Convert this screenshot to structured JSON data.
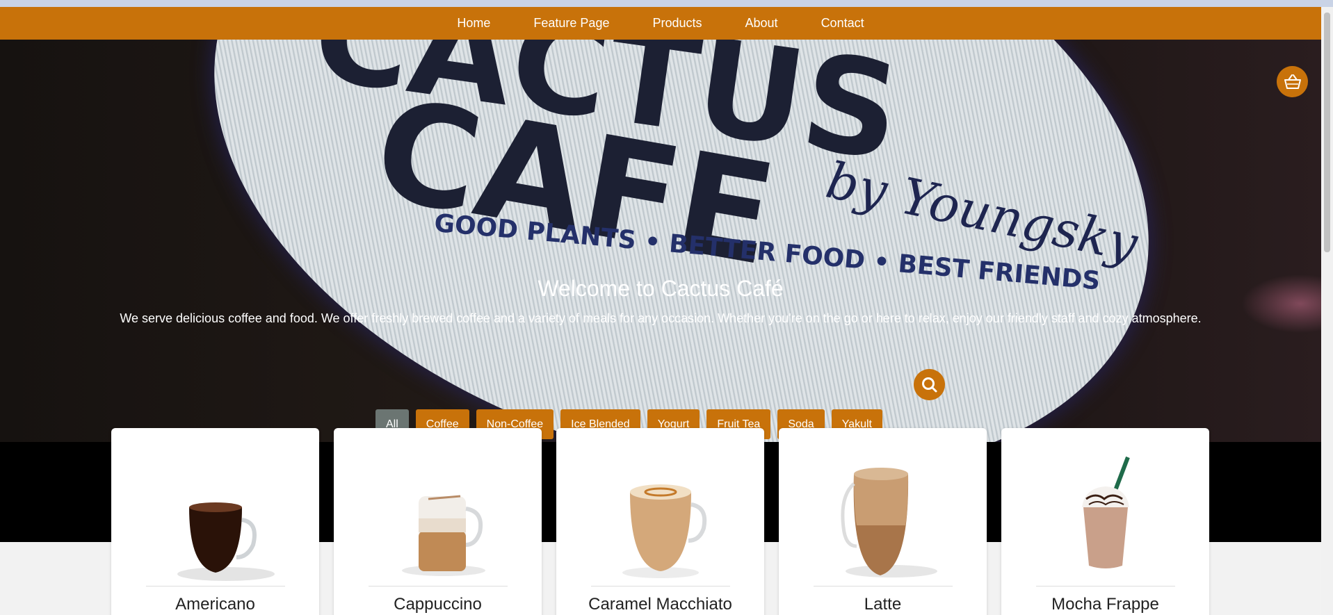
{
  "nav": {
    "items": [
      {
        "label": "Home"
      },
      {
        "label": "Feature Page"
      },
      {
        "label": "Products"
      },
      {
        "label": "About"
      },
      {
        "label": "Contact"
      }
    ]
  },
  "hero": {
    "title": "Welcome to Cactus Café",
    "description": "We serve delicious coffee and food. We offer freshly brewed coffee and a variety of meals for any occasion. Whether you're on the go or here to relax, enjoy our friendly staff and cozy atmosphere.",
    "logo_text": {
      "line1": "CACTUS",
      "line2": "CAFE",
      "script": "by Youngsky",
      "tagline": "GOOD PLANTS • BETTER FOOD • BEST FRIENDS"
    }
  },
  "filters": [
    {
      "label": "All",
      "active": true
    },
    {
      "label": "Coffee"
    },
    {
      "label": "Non-Coffee"
    },
    {
      "label": "Ice Blended"
    },
    {
      "label": "Yogurt"
    },
    {
      "label": "Fruit Tea"
    },
    {
      "label": "Soda"
    },
    {
      "label": "Yakult"
    }
  ],
  "icons": {
    "search": "search-icon",
    "cart": "basket-icon"
  },
  "colors": {
    "accent": "#c8720a",
    "active_filter": "#6b7572"
  },
  "products": [
    {
      "name": "Americano"
    },
    {
      "name": "Cappuccino"
    },
    {
      "name": "Caramel Macchiato"
    },
    {
      "name": "Latte"
    },
    {
      "name": "Mocha Frappe"
    }
  ]
}
